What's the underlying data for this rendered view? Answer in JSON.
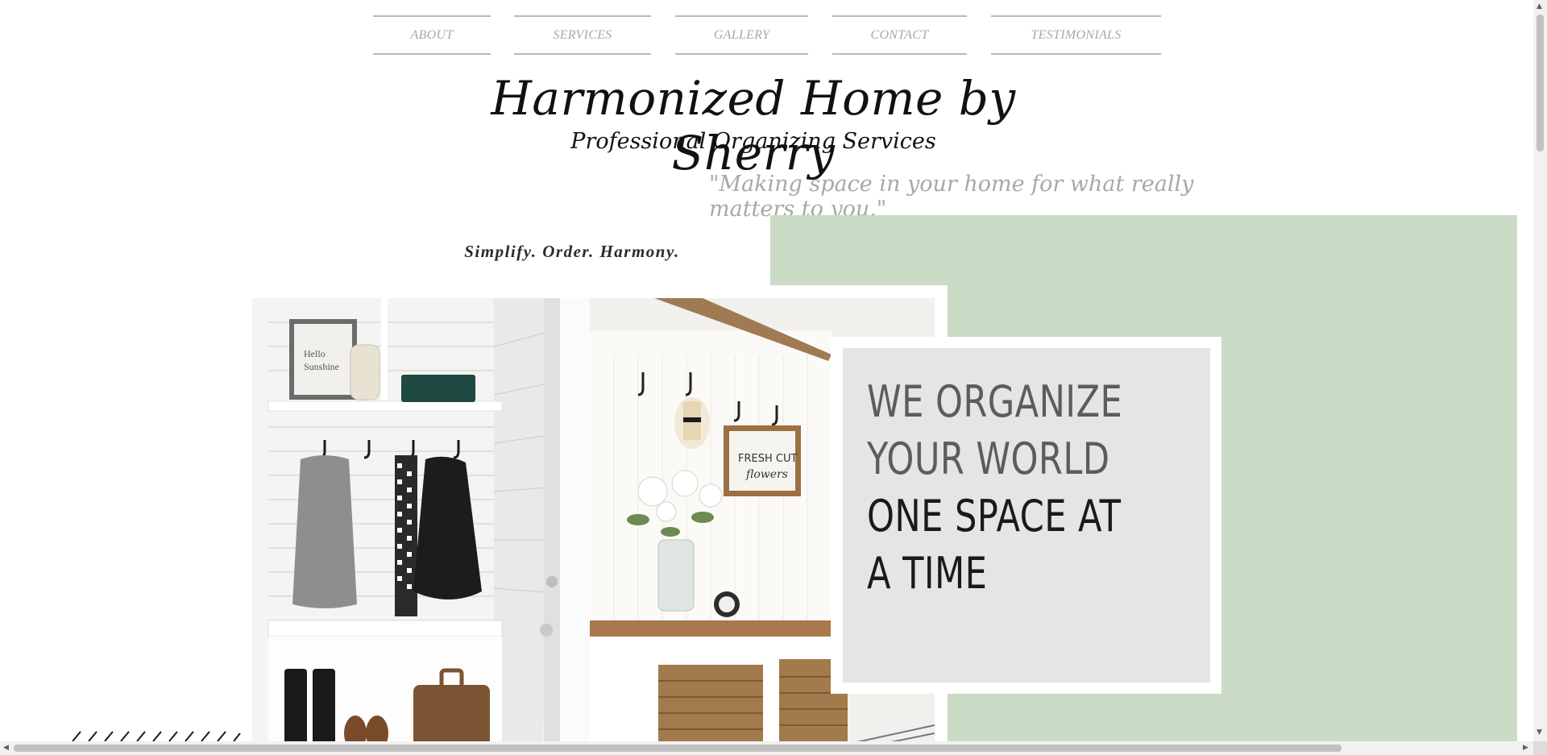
{
  "nav": {
    "items": [
      {
        "label": "ABOUT"
      },
      {
        "label": "SERVICES"
      },
      {
        "label": "GALLERY"
      },
      {
        "label": "CONTACT"
      },
      {
        "label": "TESTIMONIALS"
      }
    ]
  },
  "header": {
    "title": "Harmonized Home by Sherry",
    "subtitle": "Professional Organizing Services",
    "tagline": "\"Making space in your home for what really matters to you.\""
  },
  "hero": {
    "motto": "Simplify. Order. Harmony.",
    "card_lines": [
      "WE ORGANIZE",
      "YOUR WORLD",
      "ONE SPACE AT",
      "A TIME"
    ],
    "photo_left_sign": [
      "Hello",
      "Sunshine"
    ],
    "photo_right_sign": [
      "FRESH CUT",
      "flowers"
    ]
  },
  "colors": {
    "accent_green": "#cadbc6",
    "card_gray": "#e6e5e6",
    "nav_text": "#a8a8a8"
  },
  "icons": {
    "scroll_up": "▲",
    "scroll_down": "▼",
    "scroll_left": "◀",
    "scroll_right": "▶"
  }
}
